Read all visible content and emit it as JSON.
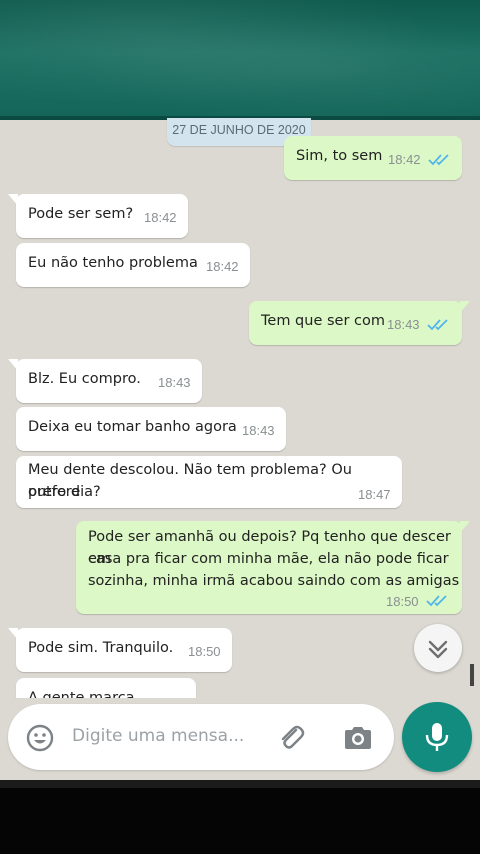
{
  "date_chip": "27 DE JUNHO DE 2020",
  "messages": [
    {
      "text": "Sim, to sem",
      "time": "18:42"
    },
    {
      "text": "Pode ser sem?",
      "time": "18:42"
    },
    {
      "text": "Eu não tenho problema",
      "time": "18:42"
    },
    {
      "text": "Tem que ser com",
      "time": "18:43"
    },
    {
      "text": "Blz. Eu compro.",
      "time": "18:43"
    },
    {
      "text": "Deixa eu tomar banho agora",
      "time": "18:43"
    },
    {
      "line1": "Meu dente descolou. Não tem problema? Ou prefere",
      "line2": "outro dia?",
      "time": "18:47"
    },
    {
      "line1": "Pode ser amanhã ou depois? Pq tenho que descer em",
      "line2": "casa pra ficar com minha mãe, ela não pode ficar",
      "line3": "sozinha, minha irmã acabou saindo com as amigas",
      "time": "18:50"
    },
    {
      "text": "Pode sim. Tranquilo.",
      "time": "18:50"
    },
    {
      "text": "A gente marca"
    }
  ],
  "input": {
    "placeholder": "Digite uma mensa..."
  },
  "icons": {
    "emoji": "emoji-icon",
    "attach": "paperclip-icon",
    "camera": "camera-icon",
    "mic": "mic-icon",
    "scroll_down": "double-chevron-down-icon",
    "read_receipt": "double-check-icon"
  },
  "colors": {
    "header": "#14665a",
    "outgoing_bubble": "#dcf8c6",
    "incoming_bubble": "#ffffff",
    "mic_button": "#128c7e",
    "read_tick": "#4fb6ec"
  }
}
